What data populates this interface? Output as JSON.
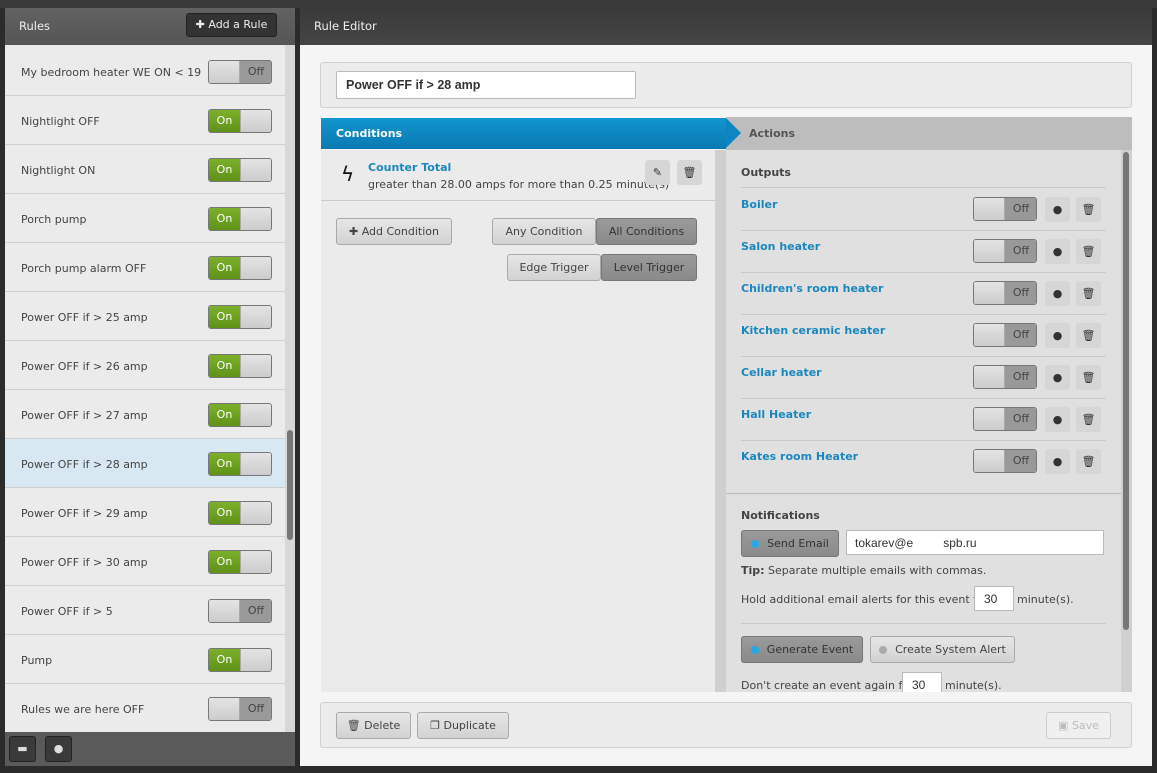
{
  "rules_panel": {
    "title": "Rules",
    "add_button": "Add a Rule",
    "items": [
      {
        "label": "My bedroom heater WE ON < 19",
        "state": "Off"
      },
      {
        "label": "Nightlight OFF",
        "state": "On"
      },
      {
        "label": "Nightlight ON",
        "state": "On"
      },
      {
        "label": "Porch pump",
        "state": "On"
      },
      {
        "label": "Porch pump alarm OFF",
        "state": "On"
      },
      {
        "label": "Power OFF if > 25 amp",
        "state": "On"
      },
      {
        "label": "Power OFF if > 26 amp",
        "state": "On"
      },
      {
        "label": "Power OFF if > 27 amp",
        "state": "On"
      },
      {
        "label": "Power OFF if > 28 amp",
        "state": "On",
        "selected": true
      },
      {
        "label": "Power OFF if > 29 amp",
        "state": "On"
      },
      {
        "label": "Power OFF if > 30 amp",
        "state": "On"
      },
      {
        "label": "Power OFF if > 5",
        "state": "Off"
      },
      {
        "label": "Pump",
        "state": "On"
      },
      {
        "label": "Rules we are here OFF",
        "state": "Off"
      }
    ],
    "footer_icons": [
      "folder-icon",
      "clock-icon"
    ]
  },
  "editor": {
    "title": "Rule Editor",
    "rule_name": "Power OFF if > 28 amp",
    "tabs": {
      "conditions": "Conditions",
      "actions": "Actions"
    },
    "condition": {
      "name": "Counter Total",
      "detail": "greater than 28.00 amps for more than 0.25 minute(s)"
    },
    "add_condition": "Add Condition",
    "any_condition": "Any Condition",
    "all_conditions": "All Conditions",
    "edge_trigger": "Edge Trigger",
    "level_trigger": "Level Trigger",
    "outputs_title": "Outputs",
    "outputs": [
      {
        "name": "Boiler",
        "state": "Off"
      },
      {
        "name": "Salon heater",
        "state": "Off"
      },
      {
        "name": "Children's room heater",
        "state": "Off"
      },
      {
        "name": "Kitchen ceramic heater",
        "state": "Off"
      },
      {
        "name": "Cellar heater",
        "state": "Off"
      },
      {
        "name": "Hall Heater",
        "state": "Off"
      },
      {
        "name": "Kates room Heater",
        "state": "Off"
      }
    ],
    "notifications": {
      "title": "Notifications",
      "send_email": "Send Email",
      "email_prefix": "tokarev@e",
      "email_suffix": "spb.ru",
      "tip_label": "Tip:",
      "tip": "Separate multiple emails with commas.",
      "hold_text": "Hold additional email alerts for this event for",
      "hold_value": "30",
      "minutes": "minute(s).",
      "generate_event": "Generate Event",
      "create_alert": "Create System Alert",
      "event_text": "Don't create an event again for",
      "event_value": "30"
    },
    "delete": "Delete",
    "duplicate": "Duplicate",
    "save": "Save"
  },
  "colors": {
    "accent": "#0a85c2",
    "on_green": "#6ea322"
  }
}
